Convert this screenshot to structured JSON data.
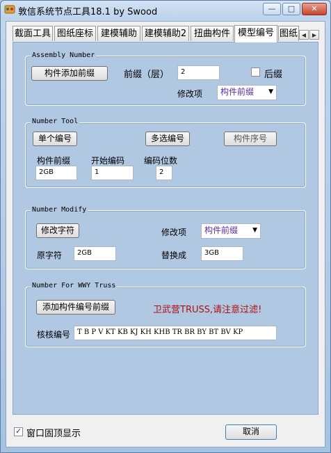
{
  "window": {
    "title": "敦信系统节点工具18.1 by Swood",
    "minimize_glyph": "—",
    "maximize_glyph": "□",
    "close_glyph": "✕"
  },
  "tabs": [
    {
      "label": "截面工具"
    },
    {
      "label": "图纸座标"
    },
    {
      "label": "建模辅助"
    },
    {
      "label": "建模辅助2"
    },
    {
      "label": "扭曲构件"
    },
    {
      "label": "模型编号",
      "active": true
    },
    {
      "label": "图纸"
    }
  ],
  "tab_scroll": {
    "left": "◀",
    "right": "▶"
  },
  "assembly": {
    "legend": "Assembly Number",
    "add_prefix_button": "构件添加前缀",
    "prefix_label": "前缀（层）",
    "prefix_value": "2",
    "suffix_label": "后缀",
    "suffix_checked": false,
    "modify_label": "修改项",
    "modify_selected": "构件前缀"
  },
  "number_tool": {
    "legend": "Number Tool",
    "single_button": "单个编号",
    "multi_button": "多选编号",
    "sequence_button": "构件序号",
    "prefix_label": "构件前缀",
    "prefix_value": "2GB",
    "start_label": "开始编码",
    "start_value": "1",
    "digits_label": "编码位数",
    "digits_value": "2"
  },
  "number_modify": {
    "legend": "Number Modify",
    "modify_button": "修改字符",
    "modify_label": "修改项",
    "modify_selected": "构件前缀",
    "original_label": "原字符",
    "original_value": "2GB",
    "replace_label": "替换成",
    "replace_value": "3GB"
  },
  "wwy_truss": {
    "legend": "Number For WWY Truss",
    "add_button": "添加构件编号前缀",
    "warning": "卫武营TRUSS,请注意过滤!",
    "check_label": "核核编号",
    "check_value": "T B P V KT KB KJ KH KHB TR BR BY BT BV KP"
  },
  "footer": {
    "pin_label": "窗口固顶显示",
    "pin_checked": true,
    "cancel_button": "取消"
  },
  "colors": {
    "warning": "#b01010",
    "select_text": "#5b2da0",
    "panel": "#b0c8e2"
  }
}
